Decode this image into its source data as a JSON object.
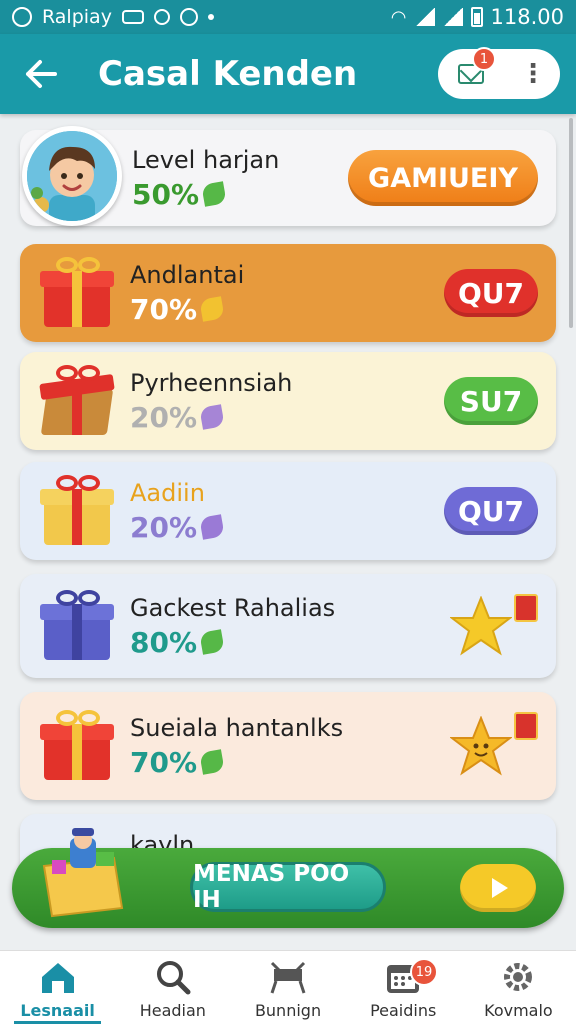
{
  "status_bar": {
    "app_name": "Ralpiay",
    "time": "118.00"
  },
  "header": {
    "title": "Casal Kenden",
    "mail_badge": "1"
  },
  "profile": {
    "label": "Level harjan",
    "percent": "50%",
    "button_label": "GAMIUEIY"
  },
  "items": [
    {
      "name": "Andlantai",
      "percent": "70%",
      "button": "QU7",
      "bg": "#e79a3d",
      "pct_color": "#ffffff",
      "btn_color": "#e0312b",
      "leaf": "#f2c230"
    },
    {
      "name": "Pyrheennsiah",
      "percent": "20%",
      "button": "SU7",
      "bg": "#fbf3d6",
      "pct_color": "#b0b0b0",
      "btn_color": "#58bd46",
      "leaf": "#a685d6"
    },
    {
      "name": "Aadiin",
      "percent": "20%",
      "button": "QU7",
      "bg": "#e5edf8",
      "pct_color": "#8c7dd0",
      "btn_color": "#6f6bd6",
      "leaf": "#9a7ad6",
      "name_color": "#e8a21d"
    },
    {
      "name": "Gackest Rahalias",
      "percent": "80%",
      "bg": "#e8eef7",
      "pct_color": "#1f9a8c",
      "leaf": "#56b847"
    },
    {
      "name": "Sueiala hantanlks",
      "percent": "70%",
      "bg": "#fbeadd",
      "pct_color": "#1f9a8c",
      "leaf": "#56b847"
    },
    {
      "name": "kayln"
    }
  ],
  "banner": {
    "button_label": "MENAS POO IH"
  },
  "nav": {
    "items": [
      {
        "label": "Lesnaail",
        "icon": "home-icon"
      },
      {
        "label": "Headian",
        "icon": "search-icon"
      },
      {
        "label": "Bunnign",
        "icon": "table-icon"
      },
      {
        "label": "Peaidins",
        "icon": "calendar-icon"
      },
      {
        "label": "Kovmalo",
        "icon": "gear-icon"
      }
    ],
    "badge": "19"
  },
  "colors": {
    "accent": "#1a9aa8",
    "orange_button": "#f58a1f",
    "green_banner": "#3d9e33"
  }
}
